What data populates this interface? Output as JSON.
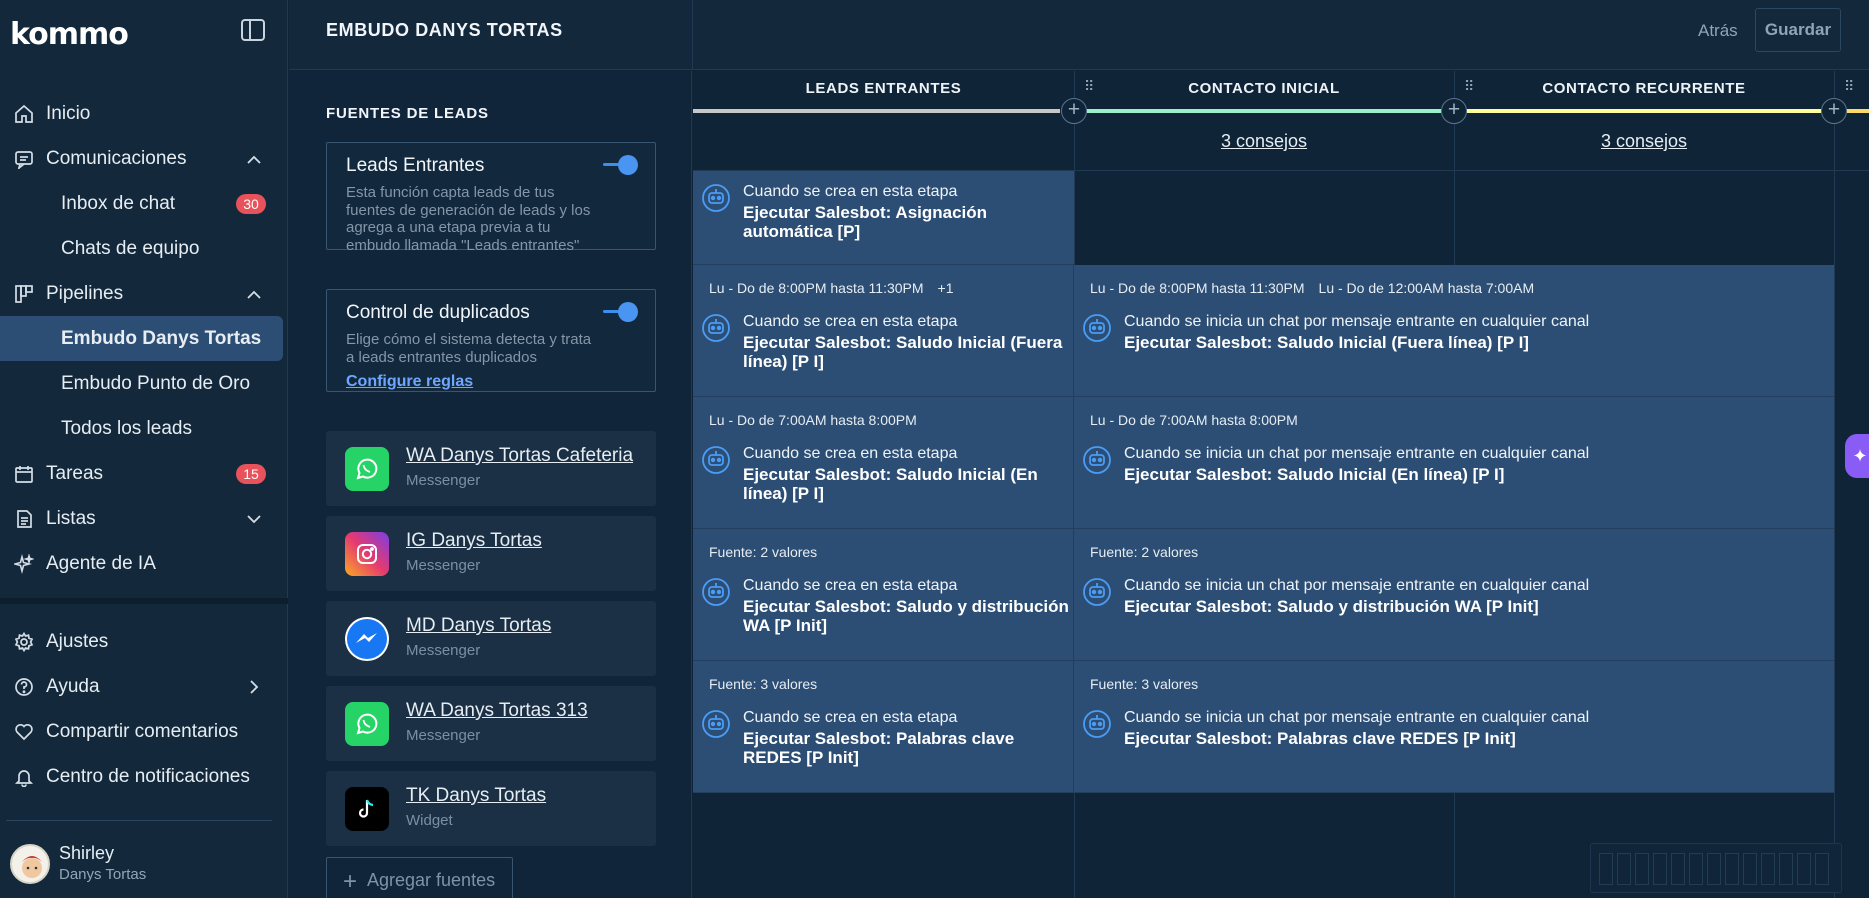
{
  "sidebar": {
    "brand": "kommo",
    "items": [
      {
        "label": "Inicio"
      },
      {
        "label": "Comunicaciones"
      },
      {
        "label": "Inbox de chat",
        "badge": "30"
      },
      {
        "label": "Chats de equipo"
      },
      {
        "label": "Pipelines"
      },
      {
        "label": "Embudo Danys Tortas"
      },
      {
        "label": "Embudo Punto de Oro"
      },
      {
        "label": "Todos los leads"
      },
      {
        "label": "Tareas",
        "badge": "15"
      },
      {
        "label": "Listas"
      },
      {
        "label": "Agente de IA"
      }
    ],
    "bottom_items": [
      {
        "label": "Ajustes"
      },
      {
        "label": "Ayuda"
      },
      {
        "label": "Compartir comentarios"
      },
      {
        "label": "Centro de notificaciones"
      }
    ],
    "user": {
      "name": "Shirley",
      "company": "Danys Tortas"
    }
  },
  "header": {
    "title": "EMBUDO DANYS TORTAS",
    "back_label": "Atrás",
    "save_label": "Guardar"
  },
  "sources": {
    "title": "FUENTES DE LEADS",
    "incoming": {
      "title": "Leads Entrantes",
      "description": "Esta función capta leads de tus fuentes de generación de leads y los agrega a una etapa previa a tu embudo llamada \"Leads entrantes\"",
      "enabled": true
    },
    "duplicates": {
      "title": "Control de duplicados",
      "description": "Elige cómo el sistema detecta y trata a leads entrantes duplicados",
      "link": "Configure reglas",
      "enabled": true
    },
    "list": [
      {
        "name": "WA Danys Tortas Cafeteria",
        "type": "Messenger",
        "icon": "whatsapp-icon"
      },
      {
        "name": "IG Danys Tortas",
        "type": "Messenger",
        "icon": "instagram-icon"
      },
      {
        "name": "MD Danys Tortas",
        "type": "Messenger",
        "icon": "messenger-icon"
      },
      {
        "name": "WA Danys Tortas 313",
        "type": "Messenger",
        "icon": "whatsapp-icon"
      },
      {
        "name": "TK Danys Tortas",
        "type": "Widget",
        "icon": "tiktok-icon"
      }
    ],
    "add_label": "Agregar fuentes"
  },
  "board": {
    "stages": [
      {
        "name": "LEADS ENTRANTES",
        "color": "#c7c7c7",
        "tips": ""
      },
      {
        "name": "CONTACTO INICIAL",
        "color": "#99f0c6",
        "tips": "3 consejos"
      },
      {
        "name": "CONTACTO RECURRENTE",
        "color": "#ffff99",
        "tips": "3 consejos"
      }
    ],
    "triggers": [
      {
        "left": {
          "conditions": [],
          "event": "Cuando se crea en esta etapa",
          "action": "Ejecutar Salesbot: Asignación automática [P]"
        },
        "right": null
      },
      {
        "left": {
          "conditions": [
            "Lu - Do de 8:00PM hasta 11:30PM",
            "+1"
          ],
          "event": "Cuando se crea en esta etapa",
          "action": "Ejecutar Salesbot: Saludo Inicial (Fuera línea) [P I]"
        },
        "right": {
          "conditions": [
            "Lu - Do de 8:00PM hasta 11:30PM",
            "Lu - Do de 12:00AM hasta 7:00AM"
          ],
          "event": "Cuando se inicia un chat por mensaje entrante en cualquier canal",
          "action": "Ejecutar Salesbot: Saludo Inicial (Fuera línea) [P I]"
        }
      },
      {
        "left": {
          "conditions": [
            "Lu - Do de 7:00AM hasta 8:00PM"
          ],
          "event": "Cuando se crea en esta etapa",
          "action": "Ejecutar Salesbot: Saludo Inicial (En línea) [P I]"
        },
        "right": {
          "conditions": [
            "Lu - Do de 7:00AM hasta 8:00PM"
          ],
          "event": "Cuando se inicia un chat por mensaje entrante en cualquier canal",
          "action": "Ejecutar Salesbot: Saludo Inicial (En línea) [P I]"
        }
      },
      {
        "left": {
          "conditions": [
            "Fuente: 2 valores"
          ],
          "event": "Cuando se crea en esta etapa",
          "action": "Ejecutar Salesbot: Saludo y distribución WA [P Init]"
        },
        "right": {
          "conditions": [
            "Fuente: 2 valores"
          ],
          "event": "Cuando se inicia un chat por mensaje entrante en cualquier canal",
          "action": "Ejecutar Salesbot: Saludo y distribución WA [P Init]"
        }
      },
      {
        "left": {
          "conditions": [
            "Fuente: 3 valores"
          ],
          "event": "Cuando se crea en esta etapa",
          "action": "Ejecutar Salesbot: Palabras clave REDES [P Init]"
        },
        "right": {
          "conditions": [
            "Fuente: 3 valores"
          ],
          "event": "Cuando se inicia un chat por mensaje entrante en cualquier canal",
          "action": "Ejecutar Salesbot: Palabras clave REDES [P Init]"
        }
      }
    ]
  },
  "colors": {
    "accent": "#3e8ef0",
    "badge": "#e8525a",
    "trigger_bg": "#2d4e74"
  }
}
